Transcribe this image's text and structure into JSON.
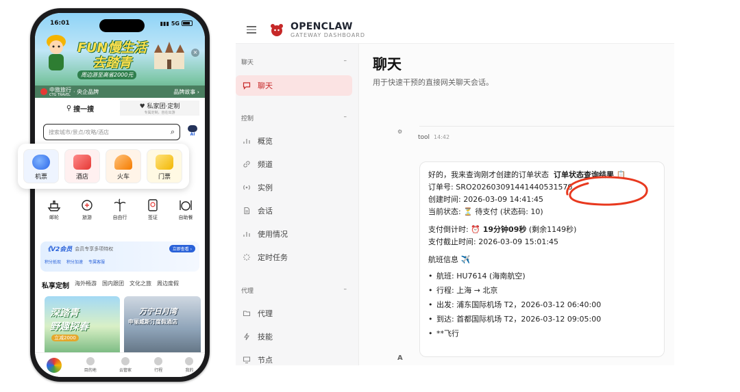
{
  "phone": {
    "status": {
      "time": "16:01",
      "network": "5G"
    },
    "banner": {
      "title1": "FUN慢生活",
      "title2": "去踏青",
      "subtitle": "周边游至高省2000元",
      "close": "×"
    },
    "brandbar": {
      "brand": "中旅旅行",
      "brand_en": "CTG TRAVEL",
      "tag": "· 央企品牌",
      "story": "品牌故事 ›"
    },
    "search_tabs": {
      "tab1": "搜一搜",
      "tab2": "私家团·定制",
      "tab2_sub": "专属定制，自在出游"
    },
    "search": {
      "placeholder": "搜索城市/景点/攻略/酒店",
      "ai_label": "AI"
    },
    "categories": [
      {
        "label": "机票",
        "icon": "plane-globe-icon"
      },
      {
        "label": "酒店",
        "icon": "hotel-icon"
      },
      {
        "label": "火车",
        "icon": "train-icon"
      },
      {
        "label": "门票",
        "icon": "ticket-icon"
      }
    ],
    "icon_row": [
      {
        "label": "邮轮"
      },
      {
        "label": "旅游"
      },
      {
        "label": "自由行"
      },
      {
        "label": "签证"
      },
      {
        "label": "自助餐"
      }
    ],
    "vip": {
      "title": "《V2会员",
      "desc": "会员专享多项特权",
      "button": "立即查看 ›",
      "feats": [
        "积分抵现",
        "积分加速",
        "专属客服"
      ]
    },
    "cat_tabs": [
      "私享定制",
      "海外畅游",
      "国内跟团",
      "文化之旅",
      "周边度假"
    ],
    "card_a": {
      "line1": "深踏青",
      "line2": "野趣探春",
      "badge": "立减2000"
    },
    "card_b": {
      "line1": "万宁日月湾",
      "line2": "申丽威斯汀度假酒店"
    },
    "bottom_nav": [
      "",
      "目的地",
      "云管家",
      "行程",
      "我的"
    ]
  },
  "dash": {
    "brand": {
      "name": "OPENCLAW",
      "sub": "GATEWAY DASHBOARD"
    },
    "sidebar": {
      "group_chat": "聊天",
      "group_control": "控制",
      "group_agent": "代理",
      "collapse": "–",
      "items": [
        {
          "label": "聊天"
        },
        {
          "label": "概览"
        },
        {
          "label": "频道"
        },
        {
          "label": "实例"
        },
        {
          "label": "会话"
        },
        {
          "label": "使用情况"
        },
        {
          "label": "定时任务"
        },
        {
          "label": "代理"
        },
        {
          "label": "技能"
        },
        {
          "label": "节点"
        }
      ]
    },
    "main": {
      "title": "聊天",
      "subtitle": "用于快速干预的直接网关聊天会话。",
      "avatar_glyph": "⚙",
      "msg_sender": "tool",
      "msg_time": "14:42",
      "intro": "好的，我来查询刚才创建的订单状态",
      "intro_highlight": "订单状态查询结果",
      "order_no_label": "订单号:",
      "order_no": "SRO20260309144144053157б",
      "created_label": "创建时间:",
      "created": "2026-03-09 14:41:45",
      "status_label": "当前状态:",
      "status": "⏳ 待支付 (状态码: 10)",
      "countdown_label": "支付倒计时:",
      "countdown_bold": "⏰ 19分钟09秒",
      "countdown_rest": "(剩余1149秒)",
      "deadline_label": "支付截止时间:",
      "deadline": "2026-03-09 15:01:45",
      "flight_label": "航班信息 ✈️",
      "flight_items": [
        {
          "key": "航班:",
          "val": "HU7614 (海南航空)"
        },
        {
          "key": "行程:",
          "val": "上海 → 北京"
        },
        {
          "key": "出发:",
          "val": "浦东国际机场 T2，2026-03-12 06:40:00"
        },
        {
          "key": "到达:",
          "val": "首都国际机场 T2，2026-03-12 09:05:00"
        },
        {
          "key": "",
          "val": "**飞行"
        }
      ],
      "bottom_avatar": "A"
    },
    "colors": {
      "accent": "#c62828",
      "active_bg": "#fbe3e3",
      "annotation": "#e8391f"
    }
  }
}
